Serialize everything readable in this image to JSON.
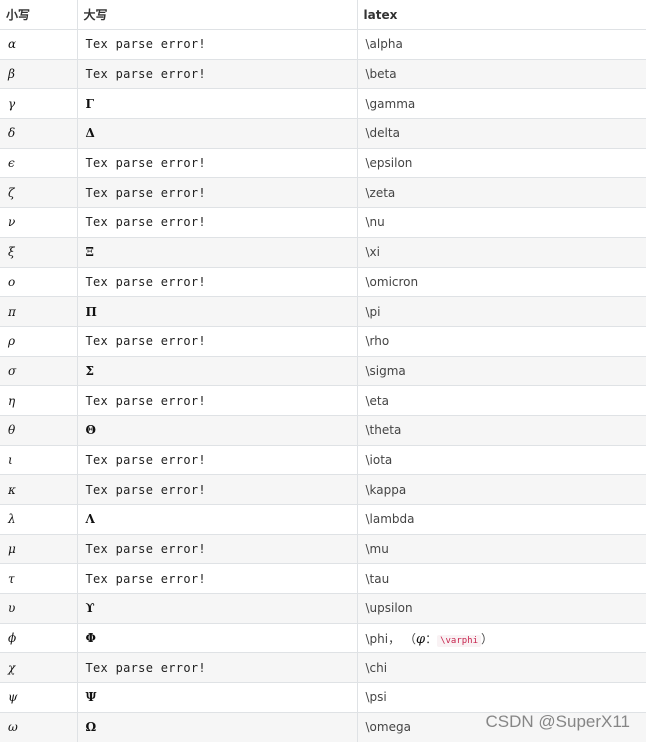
{
  "headers": {
    "lower": "小写",
    "upper": "大写",
    "latex": "latex"
  },
  "rows": [
    {
      "lower": "α",
      "upper": "Tex parse error!",
      "upper_is_error": true,
      "latex": "\\alpha"
    },
    {
      "lower": "β",
      "upper": "Tex parse error!",
      "upper_is_error": true,
      "latex": "\\beta"
    },
    {
      "lower": "γ",
      "upper": "Γ",
      "upper_is_error": false,
      "latex": "\\gamma"
    },
    {
      "lower": "δ",
      "upper": "Δ",
      "upper_is_error": false,
      "latex": "\\delta"
    },
    {
      "lower": "ϵ",
      "upper": "Tex parse error!",
      "upper_is_error": true,
      "latex": "\\epsilon"
    },
    {
      "lower": "ζ",
      "upper": "Tex parse error!",
      "upper_is_error": true,
      "latex": "\\zeta"
    },
    {
      "lower": "ν",
      "upper": "Tex parse error!",
      "upper_is_error": true,
      "latex": "\\nu"
    },
    {
      "lower": "ξ",
      "upper": "Ξ",
      "upper_is_error": false,
      "latex": "\\xi"
    },
    {
      "lower": "o",
      "upper": "Tex parse error!",
      "upper_is_error": true,
      "latex": "\\omicron"
    },
    {
      "lower": "π",
      "upper": "Π",
      "upper_is_error": false,
      "latex": "\\pi"
    },
    {
      "lower": "ρ",
      "upper": "Tex parse error!",
      "upper_is_error": true,
      "latex": "\\rho"
    },
    {
      "lower": "σ",
      "upper": "Σ",
      "upper_is_error": false,
      "latex": "\\sigma"
    },
    {
      "lower": "η",
      "upper": "Tex parse error!",
      "upper_is_error": true,
      "latex": "\\eta"
    },
    {
      "lower": "θ",
      "upper": "Θ",
      "upper_is_error": false,
      "latex": "\\theta"
    },
    {
      "lower": "ι",
      "upper": "Tex parse error!",
      "upper_is_error": true,
      "latex": "\\iota"
    },
    {
      "lower": "κ",
      "upper": "Tex parse error!",
      "upper_is_error": true,
      "latex": "\\kappa"
    },
    {
      "lower": "λ",
      "upper": "Λ",
      "upper_is_error": false,
      "latex": "\\lambda"
    },
    {
      "lower": "μ",
      "upper": "Tex parse error!",
      "upper_is_error": true,
      "latex": "\\mu"
    },
    {
      "lower": "τ",
      "upper": "Tex parse error!",
      "upper_is_error": true,
      "latex": "\\tau"
    },
    {
      "lower": "υ",
      "upper": "ϒ",
      "upper_is_error": false,
      "latex": "\\upsilon"
    },
    {
      "lower": "ϕ",
      "upper": "Φ",
      "upper_is_error": false,
      "latex": "\\phi，",
      "latex_note": {
        "open": "（",
        "symbol": "φ",
        "sep": "：",
        "code": "\\varphi",
        "close": "）"
      }
    },
    {
      "lower": "χ",
      "upper": "Tex parse error!",
      "upper_is_error": true,
      "latex": "\\chi"
    },
    {
      "lower": "ψ",
      "upper": "Ψ",
      "upper_is_error": false,
      "latex": "\\psi"
    },
    {
      "lower": "ω",
      "upper": "Ω",
      "upper_is_error": false,
      "latex": "\\omega"
    }
  ],
  "watermark": "CSDN @SuperX11"
}
